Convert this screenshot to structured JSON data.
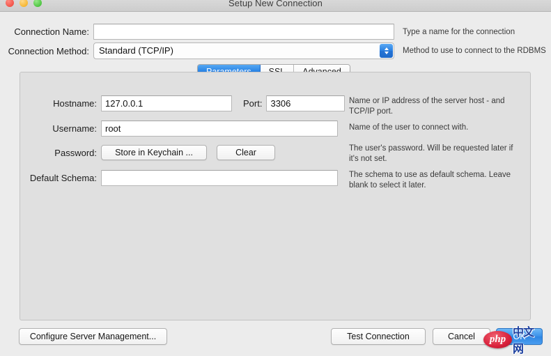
{
  "window": {
    "title": "Setup New Connection",
    "controls": {
      "close": "close-button",
      "minimize": "minimize-button",
      "maximize": "maximize-button"
    }
  },
  "top_form": {
    "connection_name": {
      "label": "Connection Name:",
      "value": "",
      "placeholder": "",
      "hint": "Type a name for the connection"
    },
    "connection_method": {
      "label": "Connection Method:",
      "value": "Standard (TCP/IP)",
      "hint": "Method to use to connect to the RDBMS"
    }
  },
  "tabs": [
    {
      "label": "Parameters",
      "active": true
    },
    {
      "label": "SSL",
      "active": false
    },
    {
      "label": "Advanced",
      "active": false
    }
  ],
  "parameters": {
    "hostname": {
      "label": "Hostname:",
      "value": "127.0.0.1",
      "hint": "Name or IP address of the server host - and TCP/IP port."
    },
    "port": {
      "label": "Port:",
      "value": "3306"
    },
    "username": {
      "label": "Username:",
      "value": "root",
      "hint": "Name of the user to connect with."
    },
    "password": {
      "label": "Password:",
      "store_button": "Store in Keychain ...",
      "clear_button": "Clear",
      "hint": "The user's password. Will be requested later if it's not set."
    },
    "default_schema": {
      "label": "Default Schema:",
      "value": "",
      "hint": "The schema to use as default schema. Leave blank to select it later."
    }
  },
  "footer": {
    "configure": "Configure Server Management...",
    "test": "Test Connection",
    "cancel": "Cancel",
    "ok": "OK"
  },
  "watermark": {
    "badge": "php",
    "text": "中文网"
  },
  "colors": {
    "accent_blue": "#2b85e6",
    "window_bg": "#ececec",
    "panel_bg": "#e0e0e0",
    "field_bg": "#ffffff"
  }
}
